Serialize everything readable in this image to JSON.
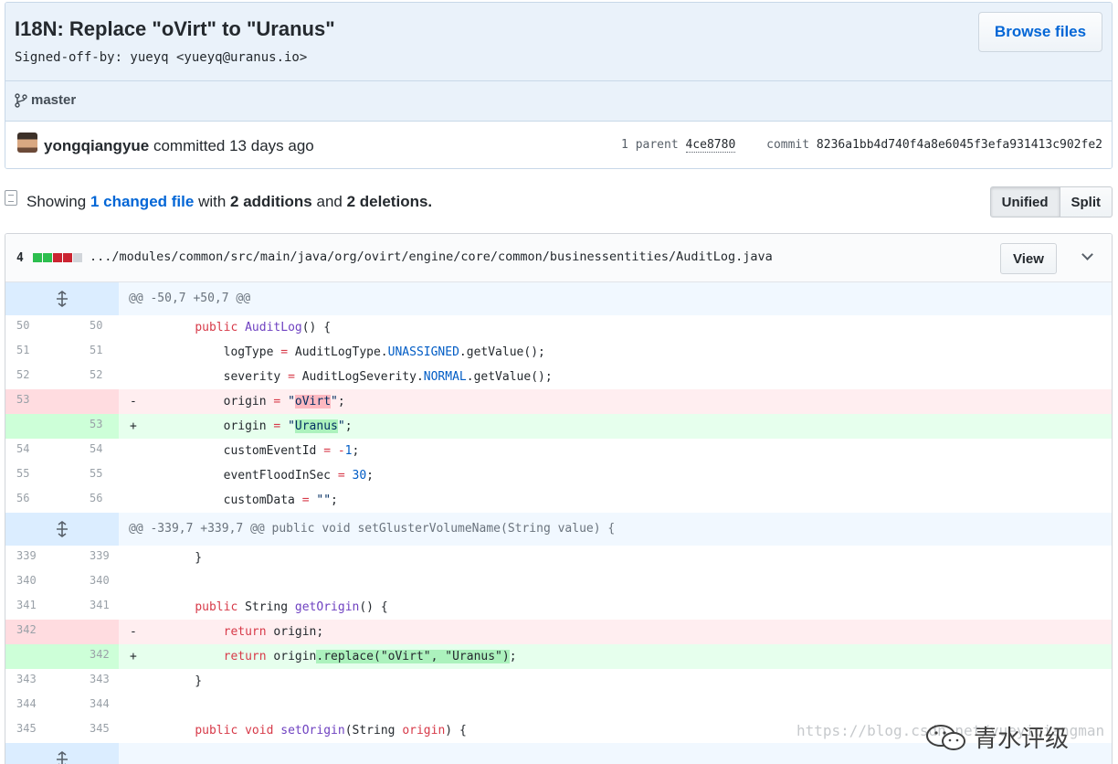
{
  "commit": {
    "title": "I18N: Replace \"oVirt\" to \"Uranus\"",
    "description": "Signed-off-by: yueyq <yueyq@uranus.io>",
    "browse_label": "Browse files",
    "branch": "master",
    "author": "yongqiangyue",
    "committed_text": "committed 13 days ago",
    "parent_label": "1 parent",
    "parent_sha": "4ce8780",
    "commit_label": "commit",
    "commit_sha": "8236a1bb4d740f4a8e6045f3efa931413c902fe2"
  },
  "toc": {
    "showing": "Showing",
    "changed_files": "1 changed file",
    "with": "with",
    "additions": "2 additions",
    "and": "and",
    "deletions": "2 deletions",
    "period": ".",
    "unified_label": "Unified",
    "split_label": "Split"
  },
  "file": {
    "change_count": "4",
    "path": ".../modules/common/src/main/java/org/ovirt/engine/core/common/businessentities/AuditLog.java",
    "view_label": "View",
    "diffstat_colors": [
      "#2cbe4e",
      "#2cbe4e",
      "#cb2431",
      "#cb2431",
      "#d1d5da"
    ]
  },
  "hunks": [
    {
      "header": "@@ -50,7 +50,7 @@",
      "lines": [
        {
          "type": "ctx",
          "old": "50",
          "new": "50",
          "marker": "",
          "tokens": [
            [
              "",
              "    "
            ],
            [
              "kw",
              "public"
            ],
            [
              "",
              " "
            ],
            [
              "fn",
              "AuditLog"
            ],
            [
              "",
              "() {"
            ]
          ]
        },
        {
          "type": "ctx",
          "old": "51",
          "new": "51",
          "marker": "",
          "tokens": [
            [
              "",
              "        logType "
            ],
            [
              "kw",
              "="
            ],
            [
              "",
              " AuditLogType."
            ],
            [
              "const",
              "UNASSIGNED"
            ],
            [
              "",
              ".getValue();"
            ]
          ]
        },
        {
          "type": "ctx",
          "old": "52",
          "new": "52",
          "marker": "",
          "tokens": [
            [
              "",
              "        severity "
            ],
            [
              "kw",
              "="
            ],
            [
              "",
              " AuditLogSeverity."
            ],
            [
              "const",
              "NORMAL"
            ],
            [
              "",
              ".getValue();"
            ]
          ]
        },
        {
          "type": "del",
          "old": "53",
          "new": "",
          "marker": "-",
          "tokens": [
            [
              "",
              "        origin "
            ],
            [
              "kw",
              "="
            ],
            [
              "",
              " "
            ],
            [
              "str",
              "\""
            ],
            [
              "str hl-del",
              "oVirt"
            ],
            [
              "str",
              "\""
            ],
            [
              "",
              ";"
            ]
          ]
        },
        {
          "type": "add",
          "old": "",
          "new": "53",
          "marker": "+",
          "tokens": [
            [
              "",
              "        origin "
            ],
            [
              "kw",
              "="
            ],
            [
              "",
              " "
            ],
            [
              "str",
              "\""
            ],
            [
              "str hl-add",
              "Uranus"
            ],
            [
              "str",
              "\""
            ],
            [
              "",
              ";"
            ]
          ]
        },
        {
          "type": "ctx",
          "old": "54",
          "new": "54",
          "marker": "",
          "tokens": [
            [
              "",
              "        customEventId "
            ],
            [
              "kw",
              "="
            ],
            [
              "",
              " "
            ],
            [
              "kw",
              "-"
            ],
            [
              "const",
              "1"
            ],
            [
              "",
              ";"
            ]
          ]
        },
        {
          "type": "ctx",
          "old": "55",
          "new": "55",
          "marker": "",
          "tokens": [
            [
              "",
              "        eventFloodInSec "
            ],
            [
              "kw",
              "="
            ],
            [
              "",
              " "
            ],
            [
              "const",
              "30"
            ],
            [
              "",
              ";"
            ]
          ]
        },
        {
          "type": "ctx",
          "old": "56",
          "new": "56",
          "marker": "",
          "tokens": [
            [
              "",
              "        customData "
            ],
            [
              "kw",
              "="
            ],
            [
              "",
              " "
            ],
            [
              "str",
              "\"\""
            ],
            [
              "",
              ";"
            ]
          ]
        }
      ]
    },
    {
      "header": "@@ -339,7 +339,7 @@ public void setGlusterVolumeName(String value) {",
      "lines": [
        {
          "type": "ctx",
          "old": "339",
          "new": "339",
          "marker": "",
          "tokens": [
            [
              "",
              "    }"
            ]
          ]
        },
        {
          "type": "ctx",
          "old": "340",
          "new": "340",
          "marker": "",
          "tokens": [
            [
              "",
              ""
            ]
          ]
        },
        {
          "type": "ctx",
          "old": "341",
          "new": "341",
          "marker": "",
          "tokens": [
            [
              "",
              "    "
            ],
            [
              "kw",
              "public"
            ],
            [
              "",
              " String "
            ],
            [
              "fn",
              "getOrigin"
            ],
            [
              "",
              "() {"
            ]
          ]
        },
        {
          "type": "del",
          "old": "342",
          "new": "",
          "marker": "-",
          "tokens": [
            [
              "",
              "        "
            ],
            [
              "kw",
              "return"
            ],
            [
              "",
              " origin;"
            ]
          ]
        },
        {
          "type": "add",
          "old": "",
          "new": "342",
          "marker": "+",
          "tokens": [
            [
              "",
              "        "
            ],
            [
              "kw",
              "return"
            ],
            [
              "",
              " origin"
            ],
            [
              "hl-add",
              ".replace(\"oVirt\", \"Uranus\")"
            ],
            [
              "",
              ";"
            ]
          ]
        },
        {
          "type": "ctx",
          "old": "343",
          "new": "343",
          "marker": "",
          "tokens": [
            [
              "",
              "    }"
            ]
          ]
        },
        {
          "type": "ctx",
          "old": "344",
          "new": "344",
          "marker": "",
          "tokens": [
            [
              "",
              ""
            ]
          ]
        },
        {
          "type": "ctx",
          "old": "345",
          "new": "345",
          "marker": "",
          "tokens": [
            [
              "",
              "    "
            ],
            [
              "kw",
              "public"
            ],
            [
              "",
              " "
            ],
            [
              "kw",
              "void"
            ],
            [
              "",
              " "
            ],
            [
              "fn",
              "setOrigin"
            ],
            [
              "",
              "(String "
            ],
            [
              "kw",
              "origin"
            ],
            [
              "",
              ") {"
            ]
          ]
        }
      ]
    }
  ],
  "watermark": {
    "url": "https://blog.csdn.net/yueyiqiangman",
    "logo_text": "青水评级"
  }
}
